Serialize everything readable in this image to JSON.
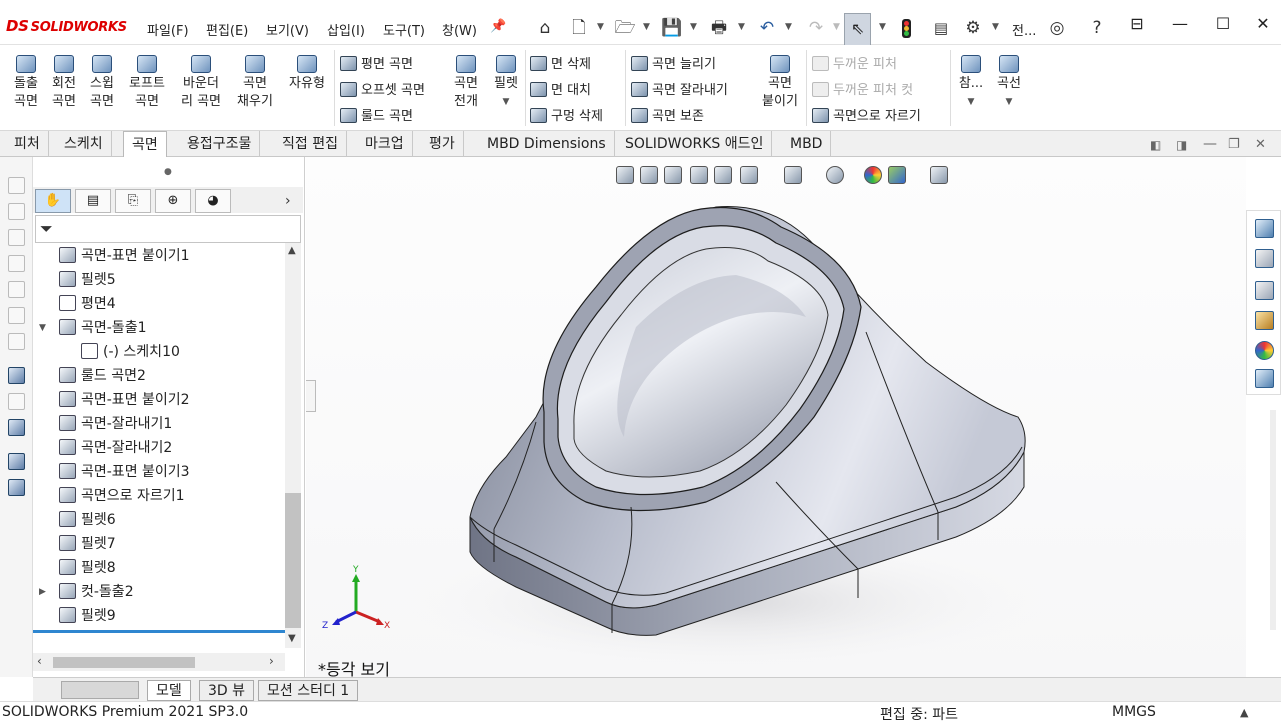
{
  "app": {
    "logo_mark": "DS",
    "logo_text": "SOLIDWORKS"
  },
  "menu": [
    "파일(F)",
    "편집(E)",
    "보기(V)",
    "삽입(I)",
    "도구(T)",
    "창(W)"
  ],
  "user_label": "전...",
  "commands": {
    "big": [
      {
        "label": "돌출\n곡면"
      },
      {
        "label": "회전\n곡면"
      },
      {
        "label": "스윕\n곡면"
      },
      {
        "label": "로프트\n곡면"
      },
      {
        "label": "바운더\n리 곡면"
      },
      {
        "label": "곡면\n채우기"
      },
      {
        "label": "자유형"
      }
    ],
    "col1": [
      "평면 곡면",
      "오프셋 곡면",
      "룰드 곡면"
    ],
    "big2": [
      {
        "label": "곡면\n전개"
      },
      {
        "label": "필렛"
      }
    ],
    "col2": [
      "면 삭제",
      "면 대치",
      "구멍 삭제"
    ],
    "col3": [
      "곡면 늘리기",
      "곡면 잘라내기",
      "곡면 보존"
    ],
    "big3": {
      "label": "곡면\n붙이기"
    },
    "col4": [
      "두꺼운 피처",
      "두꺼운 피처 컷",
      "곡면으로 자르기"
    ],
    "big4": [
      {
        "label": "참..."
      },
      {
        "label": "곡선"
      }
    ]
  },
  "tabs": [
    "피처",
    "스케치",
    "곡면",
    "용접구조물",
    "직접 편집",
    "마크업",
    "평가",
    "MBD Dimensions",
    "SOLIDWORKS 애드인",
    "MBD"
  ],
  "active_tab": "곡면",
  "tree": [
    {
      "label": "곡면-표면 붙이기1",
      "icon": "knit-surface-icon"
    },
    {
      "label": "필렛5",
      "icon": "fillet-icon"
    },
    {
      "label": "평면4",
      "icon": "plane-icon"
    },
    {
      "label": "곡면-돌출1",
      "icon": "extrude-surface-icon",
      "expanded": true
    },
    {
      "label": "(-) 스케치10",
      "icon": "sketch-icon",
      "child": true
    },
    {
      "label": "룰드 곡면2",
      "icon": "ruled-surface-icon"
    },
    {
      "label": "곡면-표면 붙이기2",
      "icon": "knit-surface-icon"
    },
    {
      "label": "곡면-잘라내기1",
      "icon": "trim-surface-icon"
    },
    {
      "label": "곡면-잘라내기2",
      "icon": "trim-surface-icon"
    },
    {
      "label": "곡면-표면 붙이기3",
      "icon": "knit-surface-icon"
    },
    {
      "label": "곡면으로 자르기1",
      "icon": "thicken-cut-icon"
    },
    {
      "label": "필렛6",
      "icon": "fillet-icon"
    },
    {
      "label": "필렛7",
      "icon": "fillet-icon"
    },
    {
      "label": "필렛8",
      "icon": "fillet-icon"
    },
    {
      "label": "컷-돌출2",
      "icon": "cut-extrude-icon",
      "collapsed": true
    },
    {
      "label": "필렛9",
      "icon": "fillet-icon"
    }
  ],
  "view_label": "*등각 보기",
  "bottom_tabs": [
    "모델",
    "3D 뷰",
    "모션 스터디 1"
  ],
  "triad": {
    "x": "X",
    "y": "Y",
    "z": "Z"
  },
  "status": {
    "product": "SOLIDWORKS Premium 2021 SP3.0",
    "mode": "편집 중: 파트",
    "units": "MMGS"
  }
}
